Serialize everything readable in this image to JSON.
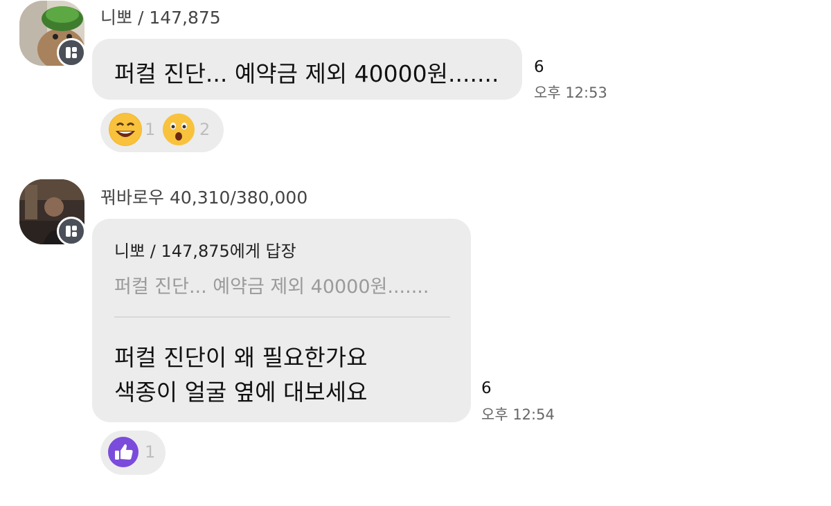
{
  "messages": [
    {
      "sender": "니뽀 / 147,875",
      "text": "퍼컬 진단... 예약금 제외 40000원.......",
      "unread": "6",
      "time": "오후 12:53",
      "reactions": [
        {
          "icon": "grinning-face-icon",
          "count": "1"
        },
        {
          "icon": "surprised-face-icon",
          "count": "2"
        }
      ]
    },
    {
      "sender": "꿔바로우 40,310/380,000",
      "reply_to": "니뽀 / 147,875에게 답장",
      "quoted_text": "퍼컬 진단... 예약금 제외 40000원.......",
      "lines": [
        "퍼컬 진단이 왜 필요한가요",
        "색종이 얼굴 옆에 대보세요"
      ],
      "unread": "6",
      "time": "오후 12:54",
      "reactions": [
        {
          "icon": "thumbs-up-icon",
          "count": "1"
        }
      ]
    }
  ],
  "colors": {
    "bubble": "#ececec",
    "badge": "#4a4f58",
    "thumbs_up": "#7b4bdc",
    "emoji_yellow": "#f7b52c"
  }
}
